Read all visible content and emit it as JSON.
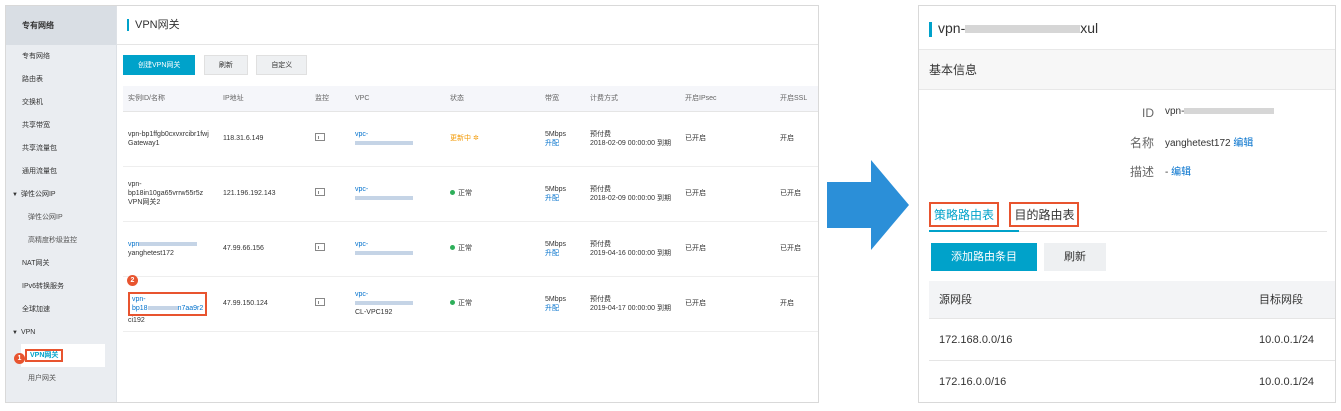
{
  "left": {
    "sidebar": {
      "header": "专有网络",
      "items": [
        {
          "label": "专有网络"
        },
        {
          "label": "路由表"
        },
        {
          "label": "交换机"
        },
        {
          "label": "共享带宽"
        },
        {
          "label": "共享流量包"
        },
        {
          "label": "通用流量包"
        },
        {
          "label": "弹性公网IP",
          "group": true
        },
        {
          "label": "弹性公网IP",
          "sub": true
        },
        {
          "label": "高精度秒级监控",
          "sub": true
        },
        {
          "label": "NAT网关"
        },
        {
          "label": "IPv6转换服务"
        },
        {
          "label": "全球加速"
        },
        {
          "label": "VPN",
          "group": true
        }
      ],
      "active": "VPN网关",
      "last": "用户网关",
      "badge1": "1"
    },
    "title": "VPN网关",
    "buttons": {
      "create": "创建VPN网关",
      "refresh": "刷新",
      "custom": "自定义"
    },
    "columns": [
      "实例ID/名称",
      "IP地址",
      "监控",
      "VPC",
      "状态",
      "带宽",
      "计费方式",
      "开启IPsec",
      "开启SSL"
    ],
    "rows": [
      {
        "id1": "vpn-bp1ffgb0cxvxrcibr1fwj",
        "id2": "Gateway1",
        "ip": "118.31.6.149",
        "vpc": "vpc-",
        "vpc2": "",
        "status": "更新中",
        "bw": "5Mbps",
        "bw_link": "升配",
        "bill1": "预付费",
        "bill2": "2018-02-09 00:00:00 到期",
        "ipsec": "已开启",
        "ssl": "开启"
      },
      {
        "id1": "vpn-",
        "id1b": "bp18in10ga65vrrw55r5z",
        "id2": "VPN网关2",
        "ip": "121.196.192.143",
        "vpc": "vpc-",
        "vpc2": "",
        "status": "正常",
        "bw": "5Mbps",
        "bw_link": "升配",
        "bill1": "预付费",
        "bill2": "2018-02-09 00:00:00 到期",
        "ipsec": "已开启",
        "ssl": "已开启"
      },
      {
        "id1": "vpn",
        "id2": "yanghetest172",
        "ip": "47.99.66.156",
        "vpc": "vpc-",
        "vpc2": "",
        "status": "正常",
        "bw": "5Mbps",
        "bw_link": "升配",
        "bill1": "预付费",
        "bill2": "2019-04-16 00:00:00 到期",
        "ipsec": "已开启",
        "ssl": "已开启"
      },
      {
        "id1": "vpn-",
        "id1b": "bp18",
        "id1c": "n7aa9r2",
        "id2": "ci192",
        "ip": "47.99.150.124",
        "vpc": "vpc-",
        "vpc2": "CL-VPC192",
        "status": "正常",
        "bw": "5Mbps",
        "bw_link": "升配",
        "bill1": "预付费",
        "bill2": "2019-04-17 00:00:00 到期",
        "ipsec": "已开启",
        "ssl": "开启",
        "badge": "2"
      }
    ]
  },
  "right": {
    "title_prefix": "vpn-",
    "title_suffix": "xul",
    "section": "基本信息",
    "info": [
      {
        "key": "ID",
        "value": "vpn-"
      },
      {
        "key": "名称",
        "value": "yanghetest172",
        "link": "编辑"
      },
      {
        "key": "描述",
        "value": "-",
        "link": "编辑"
      }
    ],
    "tabs": [
      "策略路由表",
      "目的路由表"
    ],
    "add_button": "添加路由条目",
    "refresh_button": "刷新",
    "columns": [
      "源网段",
      "目标网段"
    ],
    "rows": [
      {
        "src": "172.168.0.0/16",
        "dst": "10.0.0.1/24"
      },
      {
        "src": "172.16.0.0/16",
        "dst": "10.0.0.1/24"
      }
    ]
  },
  "colors": {
    "accent": "#00a2ca",
    "highlight": "#e8542f",
    "arrow": "#2b8fd8",
    "link": "#0070cc"
  }
}
